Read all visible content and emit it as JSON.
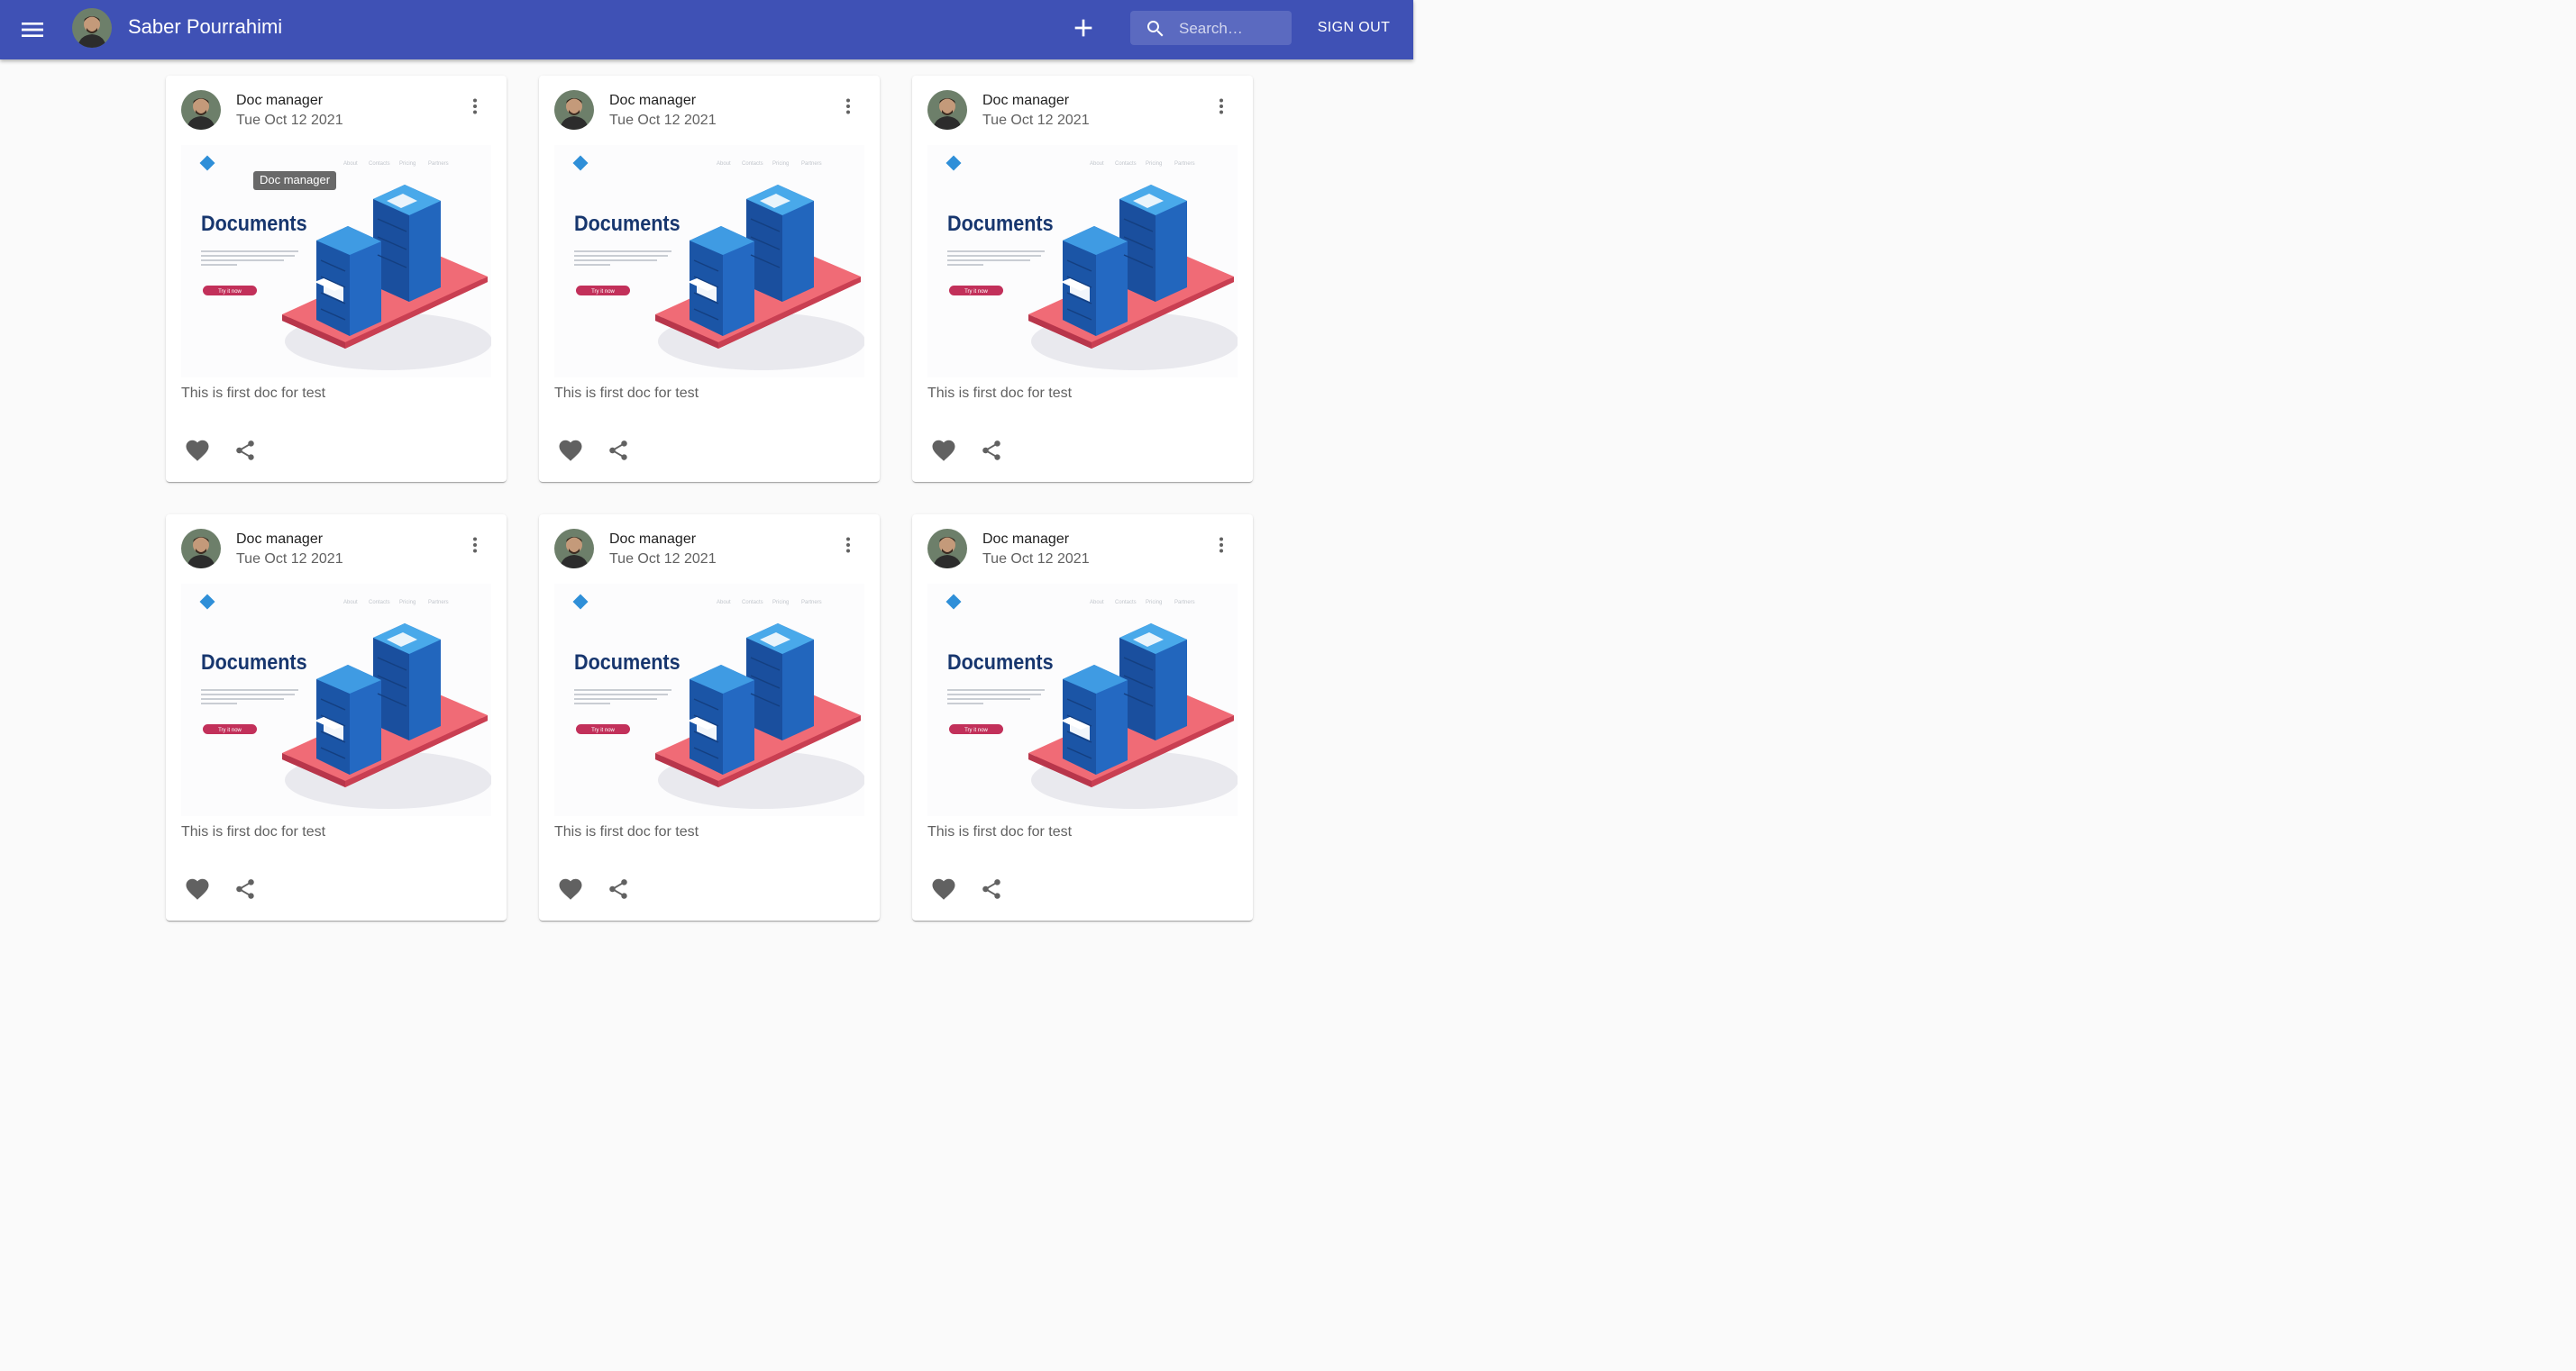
{
  "appbar": {
    "menu_icon": "menu-icon",
    "user_name": "Saber Pourrahimi",
    "add_icon": "add-icon",
    "search_placeholder": "Search…",
    "search_icon": "search-icon",
    "signout_label": "SIGN OUT"
  },
  "cards": [
    {
      "title": "Doc manager",
      "date": "Tue Oct 12 2021",
      "description": "This is first doc for test",
      "tooltip": "Doc manager"
    },
    {
      "title": "Doc manager",
      "date": "Tue Oct 12 2021",
      "description": "This is first doc for test"
    },
    {
      "title": "Doc manager",
      "date": "Tue Oct 12 2021",
      "description": "This is first doc for test"
    },
    {
      "title": "Doc manager",
      "date": "Tue Oct 12 2021",
      "description": "This is first doc for test"
    },
    {
      "title": "Doc manager",
      "date": "Tue Oct 12 2021",
      "description": "This is first doc for test"
    },
    {
      "title": "Doc manager",
      "date": "Tue Oct 12 2021",
      "description": "This is first doc for test"
    }
  ],
  "illustration": {
    "heading": "Documents",
    "button_text": "Try it now",
    "nav_items": [
      "About",
      "Contacts",
      "Pricing",
      "Partners"
    ]
  },
  "colors": {
    "appbar": "#3f51b5",
    "icon_gray": "#757575",
    "server_blue": "#1e5fb3",
    "platform_red": "#e85c6c"
  }
}
